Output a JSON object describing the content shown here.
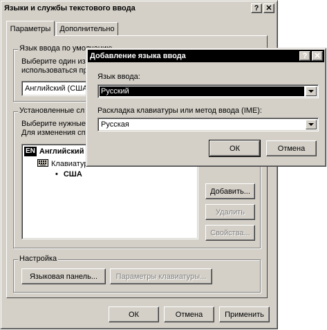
{
  "main_window": {
    "title": "Языки и службы текстового ввода",
    "help_button": "?",
    "close_button": "✕",
    "tabs": [
      {
        "label": "Параметры",
        "active": true
      },
      {
        "label": "Дополнительно",
        "active": false
      }
    ],
    "default_language": {
      "group_label": "Язык ввода по умолчанию",
      "text_line1": "Выберите один из",
      "text_line2": "использоваться пр",
      "combo_value": "Английский (США"
    },
    "installed": {
      "group_label": "Установленные сл",
      "text_line1": "Выберите нужные",
      "text_line2": "Для изменения сп",
      "tree": {
        "language_badge": "EN",
        "language_label": "Английский",
        "keyboard_label": "Клавиатур",
        "layout_label": "США"
      },
      "add_button": "Добавить...",
      "delete_button": "Удалить",
      "properties_button": "Свойства..."
    },
    "settings": {
      "group_label": "Настройка",
      "language_bar_button": "Языковая панель...",
      "key_settings_button": "Параметры клавиатуры..."
    },
    "footer": {
      "ok": "ОК",
      "cancel": "Отмена",
      "apply": "Применить"
    }
  },
  "add_dialog": {
    "title": "Добавление языка ввода",
    "help_button": "?",
    "close_button": "✕",
    "input_language_label": "Язык ввода:",
    "input_language_value": "Русский",
    "layout_label": "Раскладка клавиатуры или метод ввода (IME):",
    "layout_value": "Русская",
    "ok": "ОК",
    "cancel": "Отмена"
  }
}
